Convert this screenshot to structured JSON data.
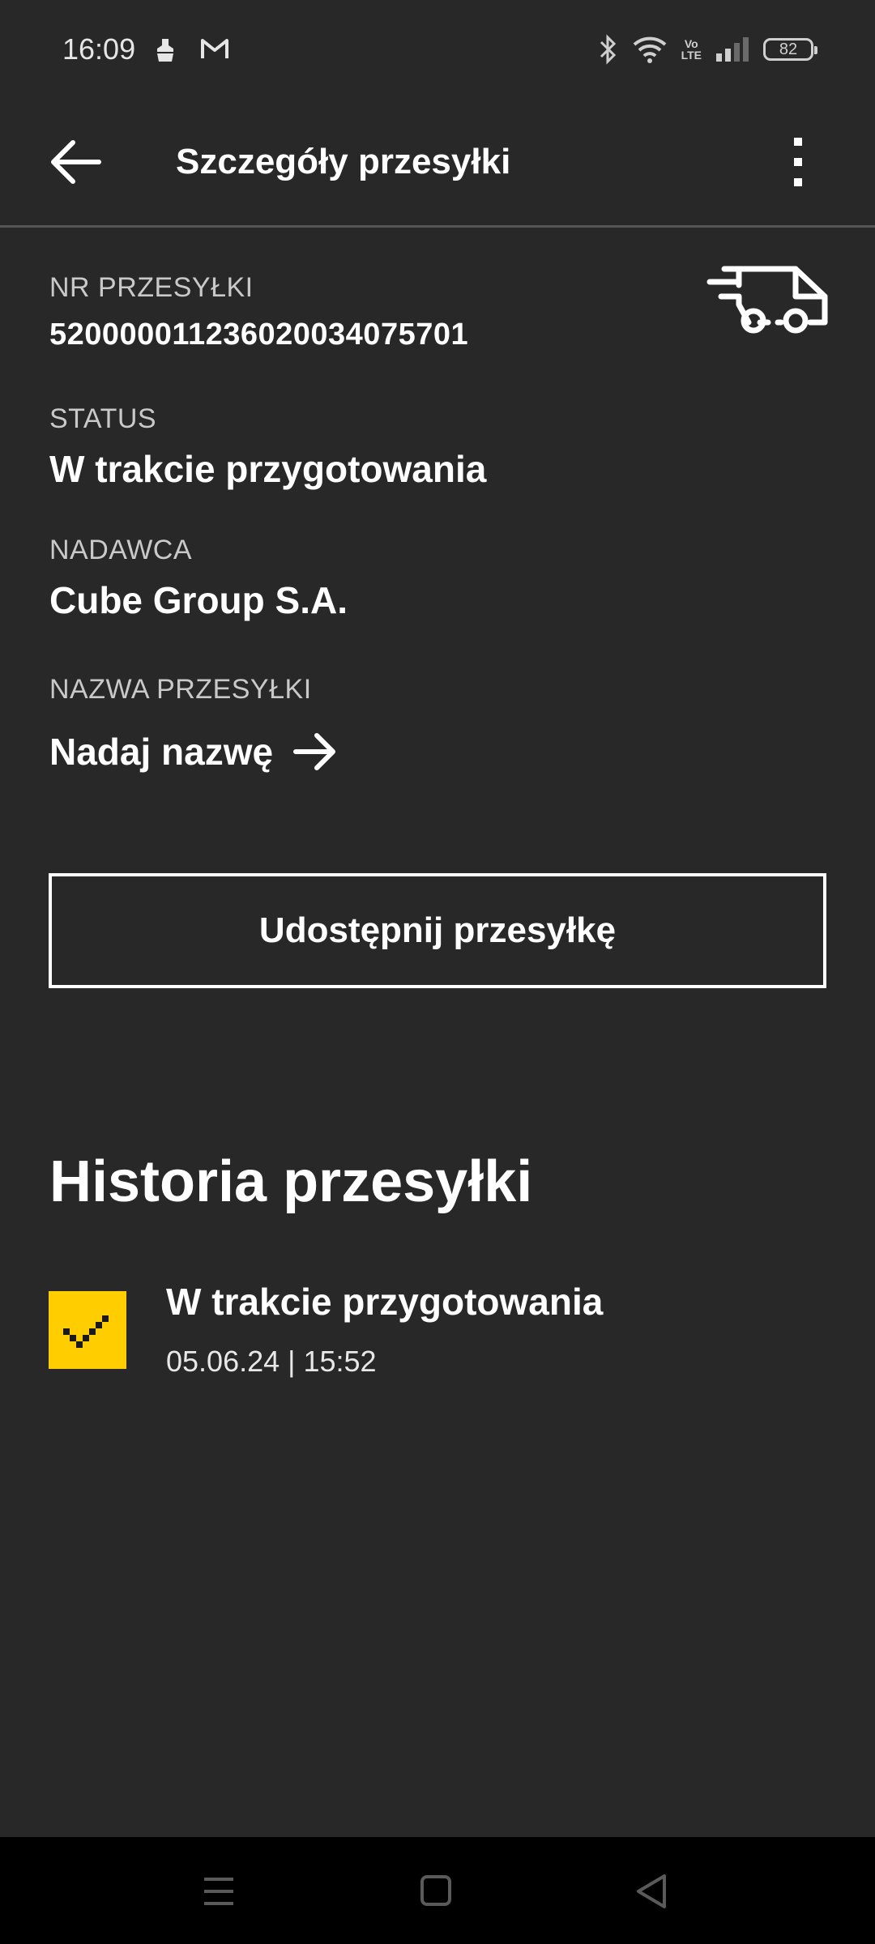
{
  "status_bar": {
    "time": "16:09",
    "battery": "82",
    "volte_line1": "Vo",
    "volte_line2": "LTE",
    "icons": [
      "cleaner-icon",
      "gmail-icon",
      "bluetooth-icon",
      "wifi-icon",
      "volte-icon",
      "signal-icon",
      "battery-icon"
    ]
  },
  "app_bar": {
    "title": "Szczegóły przesyłki",
    "back_icon": "arrow-left-icon",
    "menu_icon": "more-vert-icon"
  },
  "details": {
    "number_label": "NR PRZESYŁKI",
    "number_value": "520000011236020034075701",
    "status_label": "STATUS",
    "status_value": "W trakcie przygotowania",
    "sender_label": "NADAWCA",
    "sender_value": "Cube Group S.A.",
    "name_label": "NAZWA PRZESYŁKI",
    "name_link": "Nadaj nazwę",
    "truck_icon": "delivery-truck-icon"
  },
  "share_button": "Udostępnij przesyłkę",
  "history": {
    "title": "Historia przesyłki",
    "items": [
      {
        "title": "W trakcie przygotowania",
        "date": "05.06.24 | 15:52",
        "icon": "check-icon",
        "badge_color": "#ffcd00"
      }
    ]
  },
  "colors": {
    "background": "#282828",
    "accent": "#ffcd00",
    "text": "#ffffff"
  }
}
